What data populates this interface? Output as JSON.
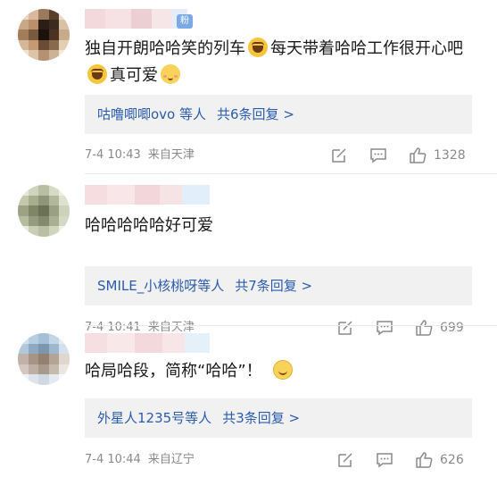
{
  "comments": [
    {
      "text_parts": [
        "独自开朗哈哈笑的列车",
        "每天带着哈哈工作很开心吧",
        "真可爱"
      ],
      "fan_badge": "粉",
      "replies_names": "咕噜唧唧ovo 等人",
      "replies_count": "共6条回复 >",
      "time": "7-4 10:43",
      "source": "来自天津",
      "likes": "1328"
    },
    {
      "text": "哈哈哈哈哈好可爱",
      "replies_names": "SMILE_小核桃呀等人",
      "replies_count": "共7条回复 >",
      "time": "7-4 10:41",
      "source": "来自天津",
      "likes": "699"
    },
    {
      "text": "哈局哈段，简称“哈哈”！",
      "replies_names": "外星人1235号等人",
      "replies_count": "共3条回复 >",
      "time": "7-4 10:44",
      "source": "来自辽宁",
      "likes": "626"
    }
  ],
  "colors": {
    "link": "#2b5cab",
    "meta": "#8a8a8a",
    "reply_bg": "#f1f1f1"
  },
  "icons": [
    "share-icon",
    "comment-icon",
    "like-icon",
    "laughing-emoji-icon",
    "shy-emoji-icon",
    "smile-emoji-icon"
  ]
}
